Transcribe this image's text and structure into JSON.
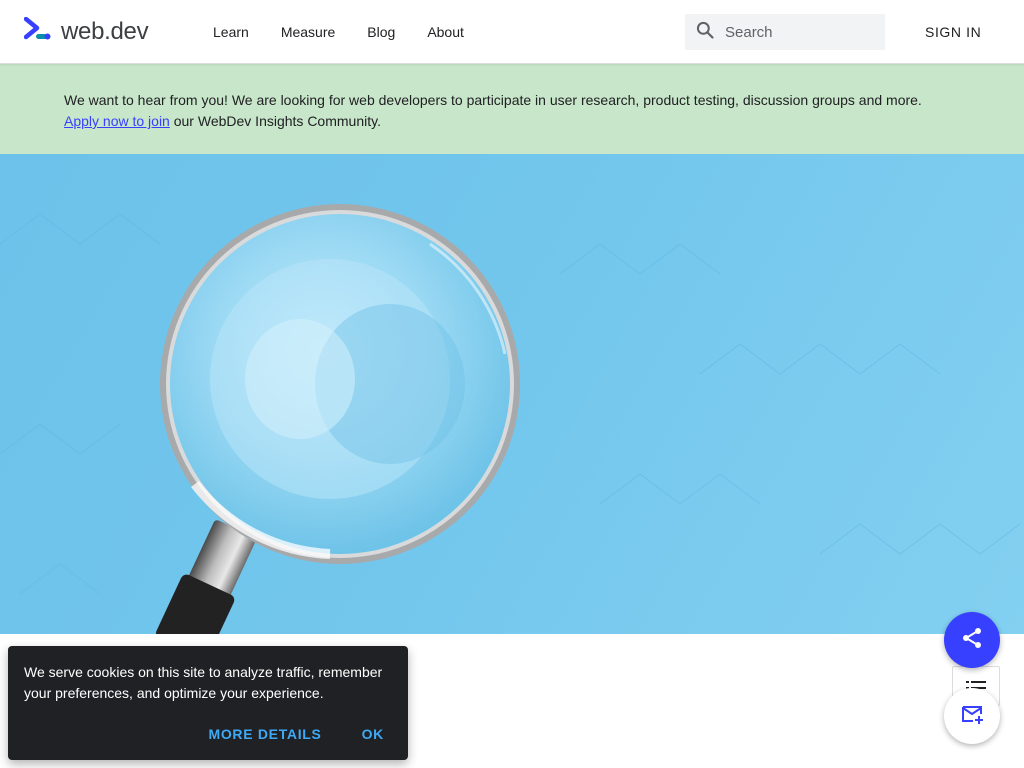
{
  "header": {
    "logo_text": "web.dev",
    "logo_icon": "webdev-logo-icon",
    "nav": [
      {
        "label": "Learn"
      },
      {
        "label": "Measure"
      },
      {
        "label": "Blog"
      },
      {
        "label": "About"
      }
    ],
    "search": {
      "placeholder": "Search",
      "icon": "search-icon"
    },
    "signin_label": "SIGN IN"
  },
  "banner": {
    "text_before": "We want to hear from you! We are looking for web developers to participate in user research, product testing, discussion groups and more.",
    "link_label": "Apply now to join",
    "text_after": " our WebDev Insights Community.",
    "link_color": "#3740ff",
    "background": "#c8e6c9"
  },
  "hero": {
    "image": "magnifying-glass-on-blue-background",
    "background": "#72c6ec"
  },
  "cookie_notice": {
    "text": "We serve cookies on this site to analyze traffic, remember your preferences, and optimize your experience.",
    "more_details_label": "MORE DETAILS",
    "ok_label": "OK",
    "action_color": "#3fa9f5"
  },
  "floating": {
    "share_icon": "share-icon",
    "toc_icon": "table-of-contents-icon",
    "subscribe_icon": "subscribe-mail-icon",
    "accent": "#3740ff"
  }
}
